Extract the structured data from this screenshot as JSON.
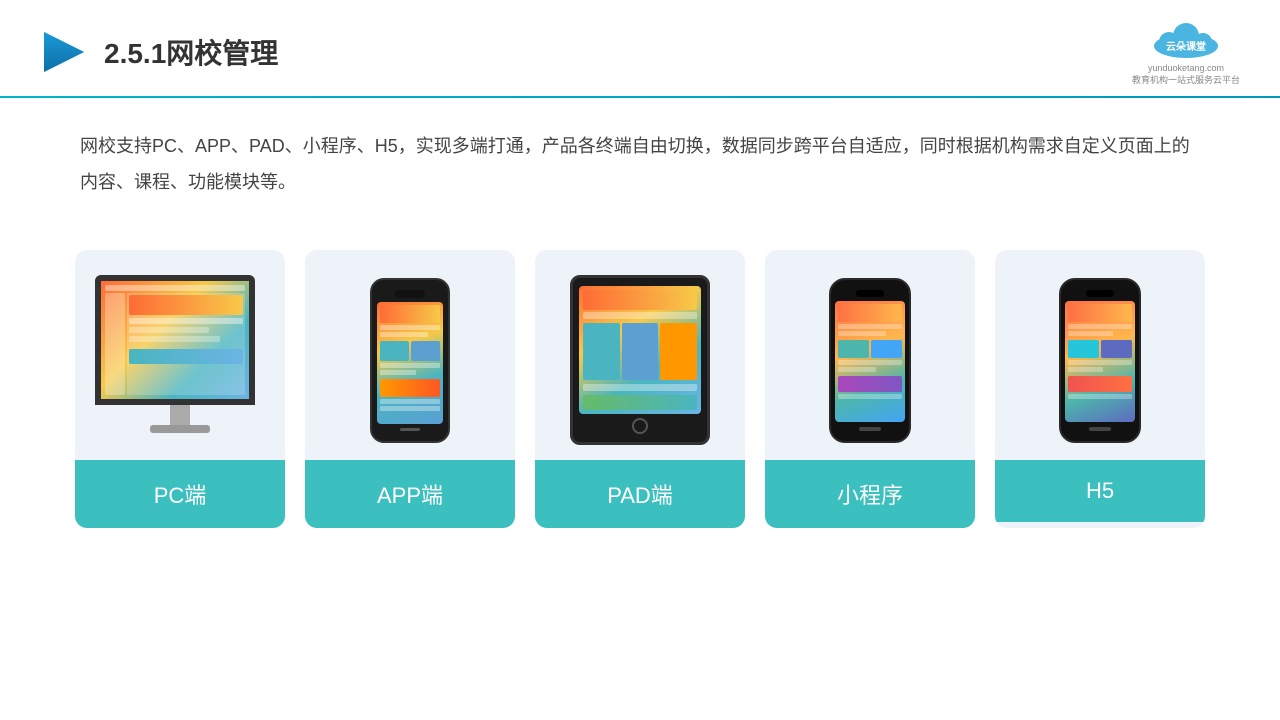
{
  "header": {
    "title": "2.5.1网校管理",
    "logo_name": "云朵课堂",
    "logo_sub": "yunduoketang.com",
    "logo_tagline": "教育机构一站式服务云平台"
  },
  "description": {
    "text": "网校支持PC、APP、PAD、小程序、H5，实现多端打通，产品各终端自由切换，数据同步跨平台自适应，同时根据机构需求自定义页面上的内容、课程、功能模块等。"
  },
  "cards": [
    {
      "id": "pc",
      "label": "PC端"
    },
    {
      "id": "app",
      "label": "APP端"
    },
    {
      "id": "pad",
      "label": "PAD端"
    },
    {
      "id": "miniprogram",
      "label": "小程序"
    },
    {
      "id": "h5",
      "label": "H5"
    }
  ],
  "colors": {
    "accent": "#3bbfbf",
    "title": "#333333",
    "divider": "#00b4c8",
    "card_bg": "#eef2f9"
  }
}
